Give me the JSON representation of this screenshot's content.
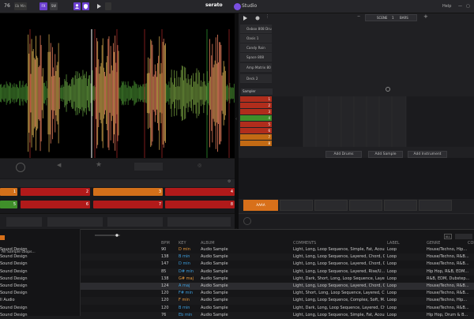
{
  "app": {
    "brand": "serato",
    "product": "Studio",
    "help": "Help",
    "bpm_label": "BPM",
    "key_label": "KEY"
  },
  "topbar": {
    "bpm": "76",
    "key": "Eb Min",
    "fx": "FX",
    "sw": "SW"
  },
  "deck": {
    "title": "Sound Design",
    "info": "BPM 138  Tempo 04:15",
    "sync": "SYNC",
    "key_display": "KEY",
    "key_value": "Eb Min",
    "mode": "WAVE"
  },
  "scene": {
    "label": "SCENE",
    "number": "1",
    "bars": "BARS"
  },
  "instruments": [
    "Oxbox 808 Drum Kit",
    "Oasis 1",
    "Candy Rain",
    "Space 808",
    "Amp Matrix 80 Sy...",
    "Deck 2",
    "Sampler"
  ],
  "tracks": [
    {
      "num": "1",
      "color": "#b02d1c"
    },
    {
      "num": "2",
      "color": "#b02d1c"
    },
    {
      "num": "3",
      "color": "#b02d1c"
    },
    {
      "num": "4",
      "color": "#3f8f2a"
    },
    {
      "num": "5",
      "color": "#b02d1c"
    },
    {
      "num": "6",
      "color": "#b02d1c"
    },
    {
      "num": "7",
      "color": "#c26a14"
    },
    {
      "num": "8",
      "color": "#c26a14"
    }
  ],
  "add_buttons": {
    "drums": "Add Drums",
    "sample": "Add Sample",
    "instrument": "Add Instrument"
  },
  "pads": [
    "1",
    "2",
    "3",
    "4",
    "5",
    "6",
    "7",
    "8"
  ],
  "pattern": "AAAA",
  "library": {
    "sidebar_title": "All Sample Loops...",
    "columns": [
      "BPM",
      "KEY",
      "ALBUM",
      "COMMENTS",
      "LABEL",
      "GENRE",
      "COM"
    ],
    "rows": [
      {
        "title": "Sound Design",
        "bpm": "90",
        "key": "D min",
        "key_color": "#e89a3c",
        "album": "Audio Sample",
        "comments": "Light, Long, Loop Sequence, Simple, Fat, Acoustic,...",
        "label": "Loop",
        "genre": "House/Techno, Hip..."
      },
      {
        "title": "Sound Design",
        "bpm": "138",
        "key": "B min",
        "key_color": "#3da0e0",
        "album": "Audio Sample",
        "comments": "Light, Long, Loop Sequence, Layered, Chord, Com...",
        "label": "Loop",
        "genre": "House/Techno, R&B..."
      },
      {
        "title": "Sound Design",
        "bpm": "147",
        "key": "D min",
        "key_color": "#3da0e0",
        "album": "Audio Sample",
        "comments": "Light, Long, Loop Sequence, Layered, Chord, Com...",
        "label": "Loop",
        "genre": "House/Techno, R&B..."
      },
      {
        "title": "Sound Design",
        "bpm": "85",
        "key": "D# min",
        "key_color": "#3da0e0",
        "album": "Audio Sample",
        "comments": "Light, Long, Loop Sequence, Layered, Rise/U...",
        "label": "Loop",
        "genre": "Hip Hop, R&B, EDM..."
      },
      {
        "title": "Sound Design",
        "bpm": "138",
        "key": "G# maj",
        "key_color": "#e89a3c",
        "album": "Audio Sample",
        "comments": "Light, Dark, Short, Long, Loop Sequence, Layered, C...",
        "label": "Loop",
        "genre": "R&B, EDM, Dubstep..."
      },
      {
        "title": "Sound Design",
        "bpm": "124",
        "key": "A maj",
        "key_color": "#3da0e0",
        "album": "Audio Sample",
        "comments": "Light, Long, Loop Sequence, Layered, Chord, Com...",
        "label": "Loop",
        "genre": "House/Techno, R&B..."
      },
      {
        "title": "Sound Design",
        "bpm": "120",
        "key": "F# min",
        "key_color": "#3da0e0",
        "album": "Audio Sample",
        "comments": "Light, Short, Long, Loop Sequence, Layered, Chord,...",
        "label": "Loop",
        "genre": "House/Techno, R&B..."
      },
      {
        "title": "ll Audio",
        "bpm": "120",
        "key": "F min",
        "key_color": "#e89a3c",
        "album": "Audio Sample",
        "comments": "Light, Long, Loop Sequence, Complex, Soft, M...",
        "label": "Loop",
        "genre": "House/Techno, Hip..."
      },
      {
        "title": "Sound Design",
        "bpm": "120",
        "key": "B min",
        "key_color": "#3da0e0",
        "album": "Audio Sample",
        "comments": "Light, Dark, Long, Loop Sequence, Layered, Chord,...",
        "label": "Loop",
        "genre": "House/Techno, R&B..."
      },
      {
        "title": "Sound Design",
        "bpm": "76",
        "key": "Eb min",
        "key_color": "#3da0e0",
        "album": "Audio Sample",
        "comments": "Light, Long, Loop Sequence, Simple, Fat, Acous...",
        "label": "Loop",
        "genre": "Hip Hop, Drum & B..."
      }
    ]
  }
}
